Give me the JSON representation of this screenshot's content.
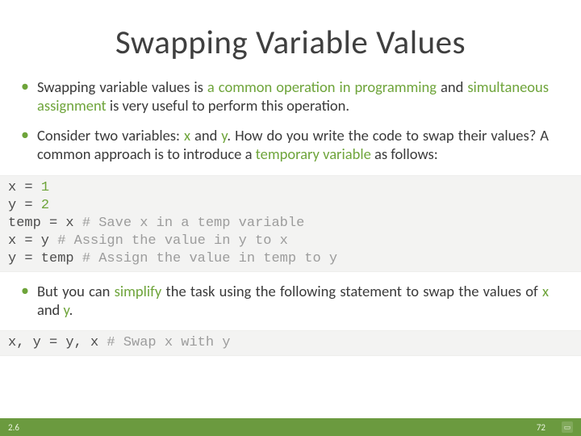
{
  "title": "Swapping Variable Values",
  "bullets": {
    "b0": {
      "pre": "Swapping variable values is ",
      "em1": "a common operation in programming",
      "mid": " and ",
      "em2": "simultaneous assignment",
      "post": " is very useful to perform this operation."
    },
    "b1": {
      "pre": "Consider two variables: ",
      "x": "x",
      "mid1": " and ",
      "y": "y",
      "mid2": ". How do you write the code to swap their values? A common approach is to introduce a ",
      "em": "temporary variable",
      "post": " as follows:"
    },
    "b2": {
      "pre": "But you can ",
      "em": "simplify",
      "mid": " the task using the following statement to swap the values of ",
      "x": "x",
      "and": " and ",
      "y": "y",
      "post": "."
    }
  },
  "code1": {
    "l0a": "x = ",
    "l0n": "1",
    "l1a": "y = ",
    "l1n": "2",
    "l2a": "temp = x ",
    "l2c": "# Save x in a temp variable",
    "l3a": "x = y ",
    "l3c": "# Assign the value in y to x",
    "l4a": "y = temp ",
    "l4c": "# Assign the value in temp to y"
  },
  "code2": {
    "a": "x, y = y, x ",
    "c": "# Swap x with y"
  },
  "footer": {
    "section": "2.6",
    "page": "72"
  }
}
